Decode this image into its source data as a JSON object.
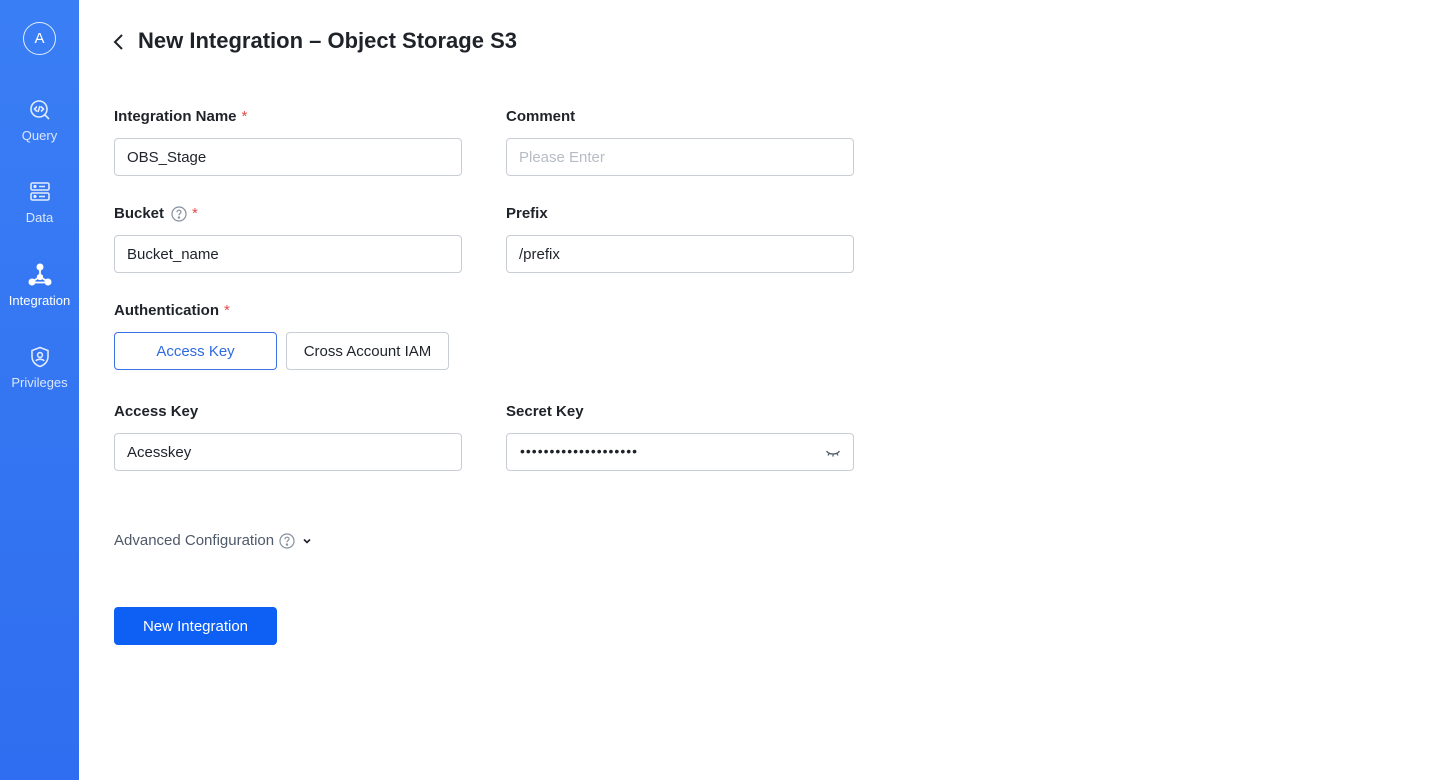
{
  "sidebar": {
    "avatar_letter": "A",
    "items": [
      {
        "label": "Query",
        "icon": "query-icon"
      },
      {
        "label": "Data",
        "icon": "data-icon"
      },
      {
        "label": "Integration",
        "icon": "integration-icon",
        "active": true
      },
      {
        "label": "Privileges",
        "icon": "shield-icon"
      }
    ]
  },
  "header": {
    "title": "New Integration – Object Storage S3"
  },
  "form": {
    "integration_name": {
      "label": "Integration Name",
      "required": "*",
      "value": "OBS_Stage"
    },
    "comment": {
      "label": "Comment",
      "placeholder": "Please Enter",
      "value": ""
    },
    "bucket": {
      "label": "Bucket",
      "required": "*",
      "value": "Bucket_name"
    },
    "prefix": {
      "label": "Prefix",
      "value": "/prefix"
    },
    "authentication": {
      "label": "Authentication",
      "required": "*",
      "options": [
        "Access Key",
        "Cross Account IAM"
      ],
      "selected": "Access Key"
    },
    "access_key": {
      "label": "Access Key",
      "value": "Acesskey"
    },
    "secret_key": {
      "label": "Secret Key",
      "masked_value": "••••••••••••••••••••"
    },
    "advanced": {
      "label": "Advanced Configuration"
    },
    "submit_label": "New Integration"
  },
  "colors": {
    "sidebar": "#3a7ef5",
    "primary": "#0e60f5",
    "required": "#e5484d",
    "selected_border": "#3a73e6"
  }
}
